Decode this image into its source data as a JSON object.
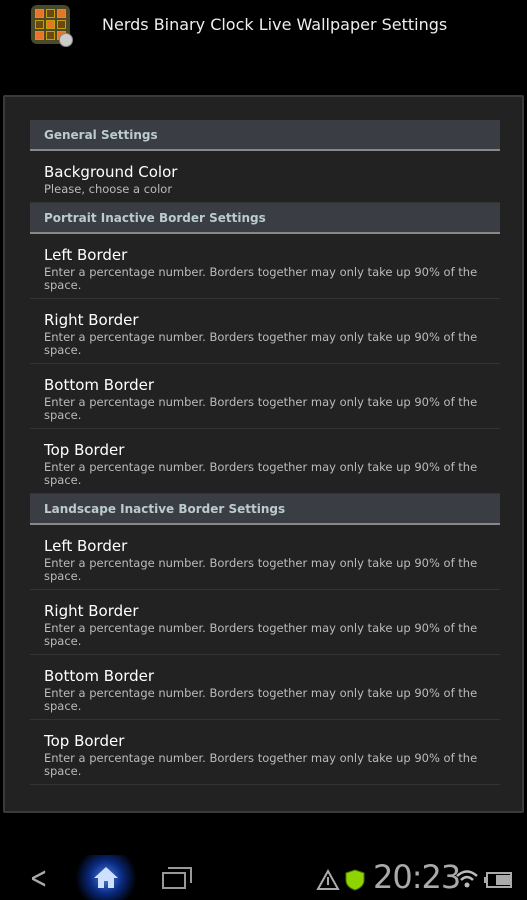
{
  "app": {
    "title": "Nerds Binary Clock Live Wallpaper Settings",
    "icon": "binary-clock-app-icon"
  },
  "sections": [
    {
      "header": "General Settings",
      "items": [
        {
          "title": "Background Color",
          "summary": "Please, choose a color"
        }
      ]
    },
    {
      "header": "Portrait Inactive Border Settings",
      "items": [
        {
          "title": "Left Border",
          "summary": "Enter a percentage number. Borders together may only take up 90% of the space."
        },
        {
          "title": "Right Border",
          "summary": "Enter a percentage number. Borders together may only take up 90% of the space."
        },
        {
          "title": "Bottom Border",
          "summary": "Enter a percentage number. Borders together may only take up 90% of the space."
        },
        {
          "title": "Top Border",
          "summary": "Enter a percentage number. Borders together may only take up 90% of the space."
        }
      ]
    },
    {
      "header": "Landscape Inactive Border Settings",
      "items": [
        {
          "title": "Left Border",
          "summary": "Enter a percentage number. Borders together may only take up 90% of the space."
        },
        {
          "title": "Right Border",
          "summary": "Enter a percentage number. Borders together may only take up 90% of the space."
        },
        {
          "title": "Bottom Border",
          "summary": "Enter a percentage number. Borders together may only take up 90% of the space."
        },
        {
          "title": "Top Border",
          "summary": "Enter a percentage number. Borders together may only take up 90% of the space."
        }
      ]
    }
  ],
  "statusbar": {
    "time": "20:23",
    "icons": [
      "warning-icon",
      "security-shield-icon",
      "wifi-icon",
      "battery-icon"
    ]
  },
  "navbar": {
    "icons": [
      "back-icon",
      "home-icon",
      "recent-apps-icon"
    ]
  },
  "colors": {
    "header_bg": "#3a3d44",
    "panel_bg": "#222222",
    "home_glow": "#4a7fe0",
    "shield": "#8fd400"
  }
}
